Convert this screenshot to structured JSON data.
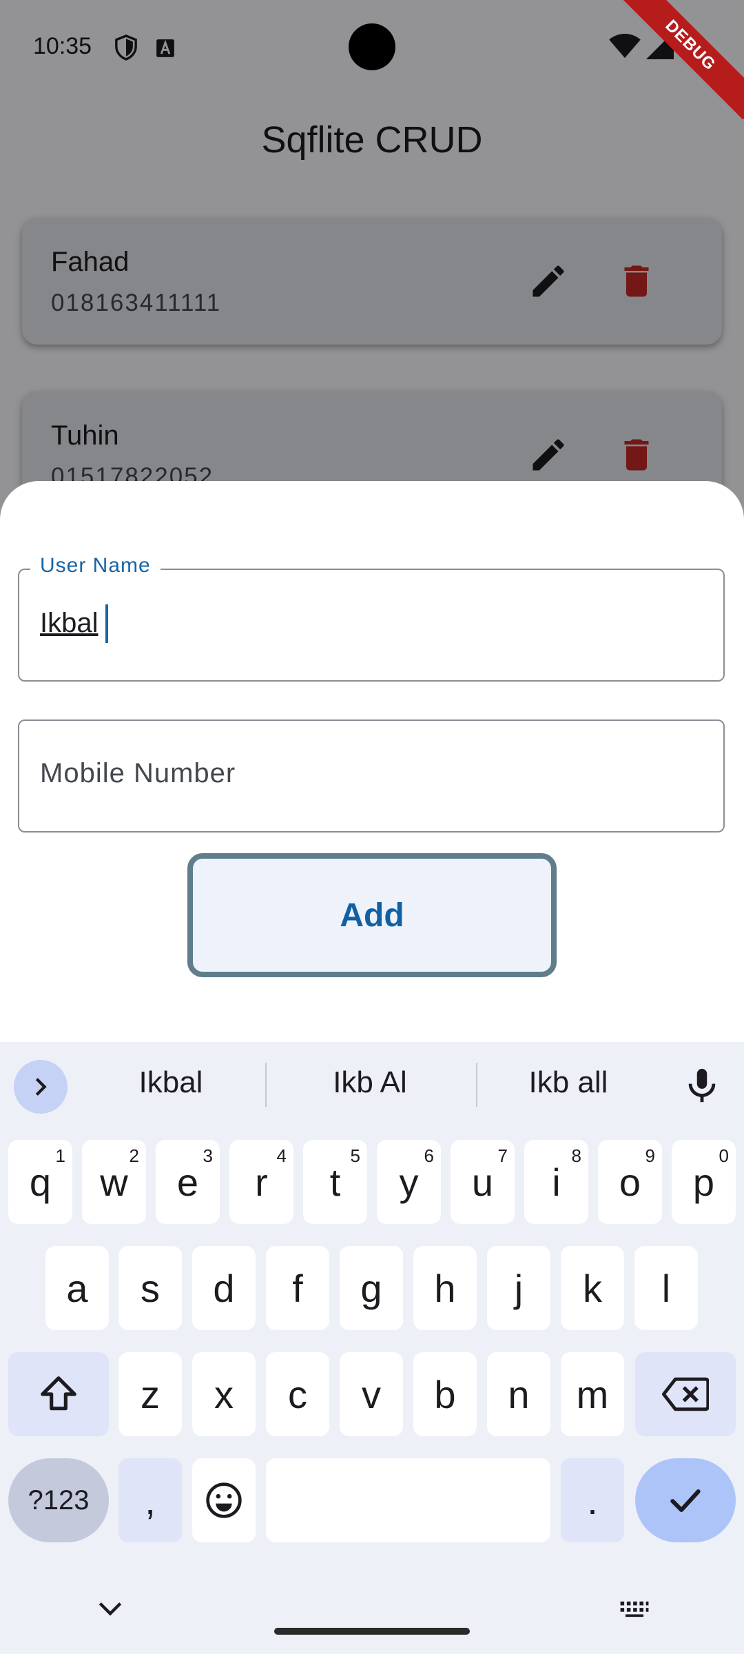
{
  "status_bar": {
    "time": "10:35",
    "debug_banner": "DEBUG"
  },
  "app": {
    "title": "Sqflite CRUD",
    "contacts": [
      {
        "name": "Fahad",
        "phone": "018163411111"
      },
      {
        "name": "Tuhin",
        "phone": "01517822052"
      }
    ],
    "colors": {
      "delete": "#c62828",
      "edit": "#1d1b20"
    }
  },
  "sheet": {
    "user_name_label": "User Name",
    "user_name_value": "Ikbal",
    "mobile_placeholder": "Mobile Number",
    "add_label": "Add",
    "accent": "#1565a7"
  },
  "keyboard": {
    "suggestions": [
      "Ikbal",
      "Ikb Al",
      "Ikb all"
    ],
    "row1": [
      {
        "key": "q",
        "hint": "1"
      },
      {
        "key": "w",
        "hint": "2"
      },
      {
        "key": "e",
        "hint": "3"
      },
      {
        "key": "r",
        "hint": "4"
      },
      {
        "key": "t",
        "hint": "5"
      },
      {
        "key": "y",
        "hint": "6"
      },
      {
        "key": "u",
        "hint": "7"
      },
      {
        "key": "i",
        "hint": "8"
      },
      {
        "key": "o",
        "hint": "9"
      },
      {
        "key": "p",
        "hint": "0"
      }
    ],
    "row2": [
      "a",
      "s",
      "d",
      "f",
      "g",
      "h",
      "j",
      "k",
      "l"
    ],
    "row3": [
      "z",
      "x",
      "c",
      "v",
      "b",
      "n",
      "m"
    ],
    "symbols_label": "?123",
    "comma": ",",
    "period": "."
  }
}
